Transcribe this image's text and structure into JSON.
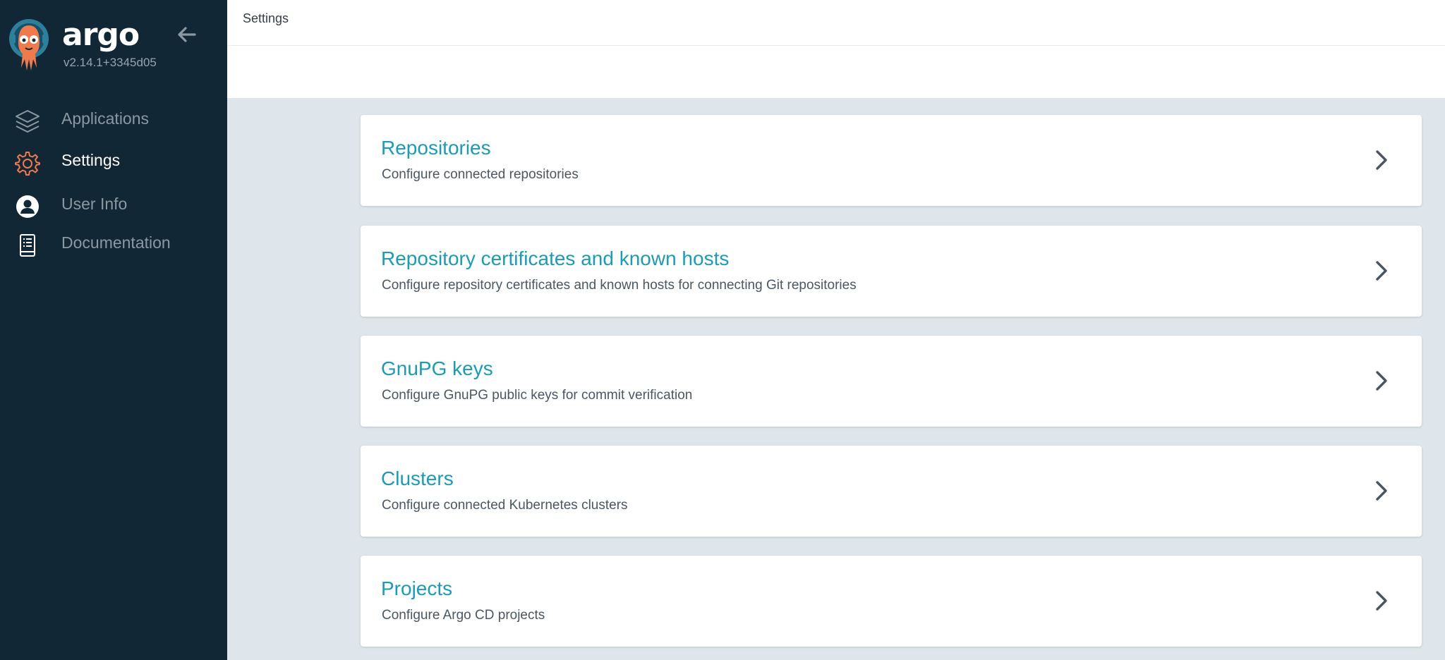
{
  "app": {
    "brand": "argo",
    "version": "v2.14.1+3345d05",
    "logo_icon": "argo-octopus-logo-icon",
    "accent_color": "#1b9bb5",
    "sidebar_bg": "#122735"
  },
  "sidebar": {
    "collapse_icon": "arrow-left-icon",
    "items": [
      {
        "label": "Applications",
        "icon": "layers-icon",
        "active": false
      },
      {
        "label": "Settings",
        "icon": "gear-icon",
        "active": true
      },
      {
        "label": "User Info",
        "icon": "user-circle-icon",
        "active": false
      },
      {
        "label": "Documentation",
        "icon": "book-icon",
        "active": false
      }
    ]
  },
  "header": {
    "title": "Settings"
  },
  "settings": {
    "cards": [
      {
        "title": "Repositories",
        "description": "Configure connected repositories"
      },
      {
        "title": "Repository certificates and known hosts",
        "description": "Configure repository certificates and known hosts for connecting Git repositories"
      },
      {
        "title": "GnuPG keys",
        "description": "Configure GnuPG public keys for commit verification"
      },
      {
        "title": "Clusters",
        "description": "Configure connected Kubernetes clusters"
      },
      {
        "title": "Projects",
        "description": "Configure Argo CD projects"
      }
    ]
  }
}
